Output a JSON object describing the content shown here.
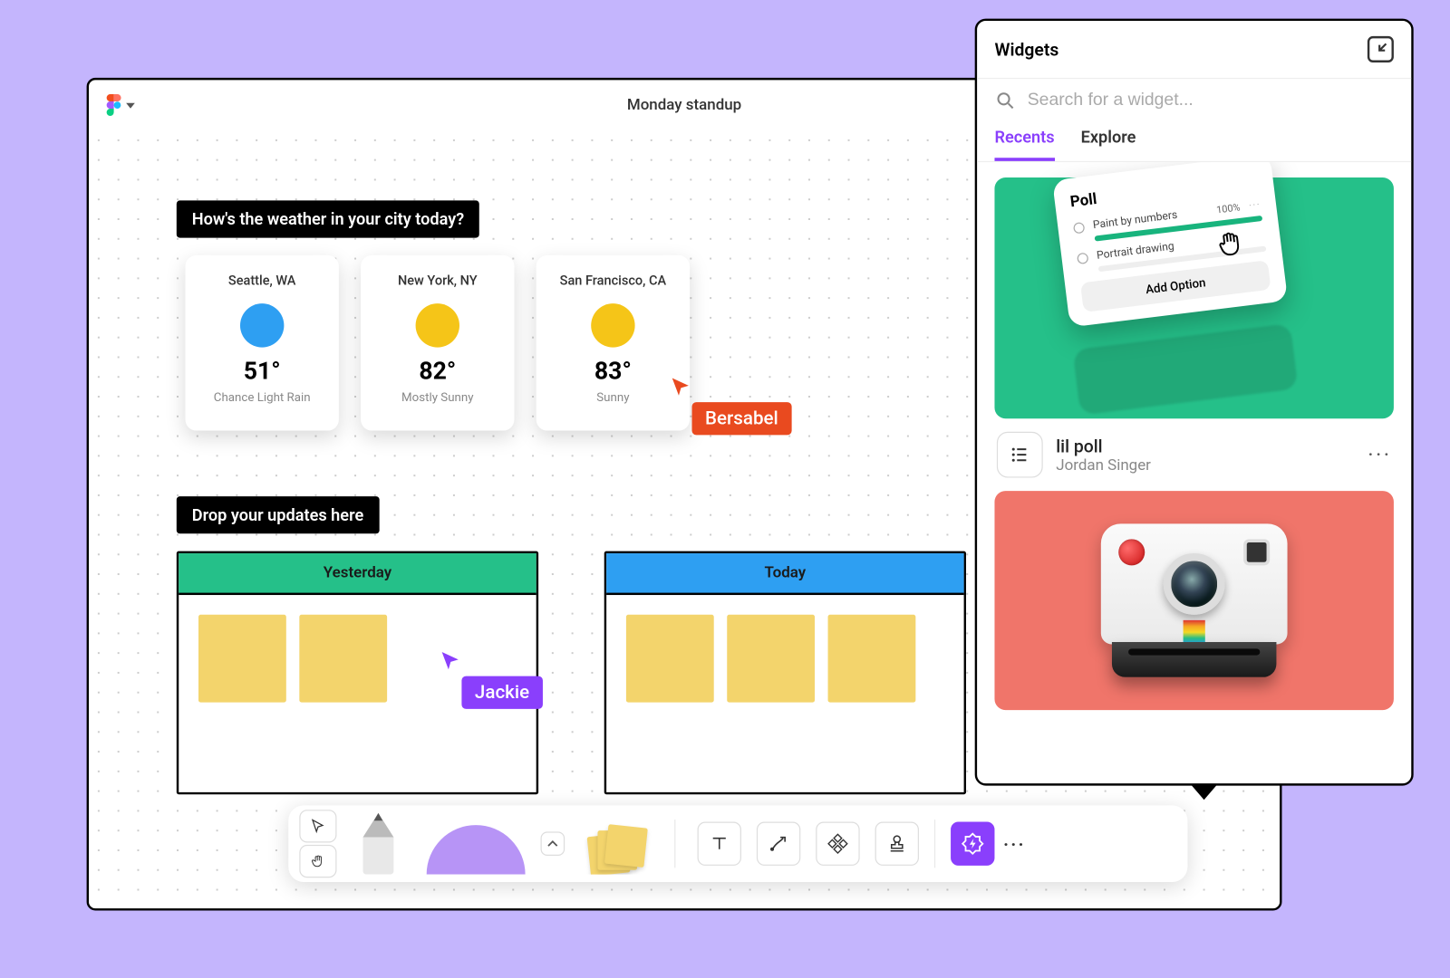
{
  "page": {
    "title": "Monday standup"
  },
  "sections": {
    "weather_q": "How's the weather in your city today?",
    "updates_q": "Drop your updates here"
  },
  "weather": [
    {
      "city": "Seattle, WA",
      "temp": "51°",
      "cond": "Chance Light Rain",
      "color": "blue"
    },
    {
      "city": "New York, NY",
      "temp": "82°",
      "cond": "Mostly Sunny",
      "color": "yellow"
    },
    {
      "city": "San Francisco, CA",
      "temp": "83°",
      "cond": "Sunny",
      "color": "yellow"
    }
  ],
  "cursors": {
    "red_user": "Bersabel",
    "purple_user": "Jackie"
  },
  "boards": {
    "left": "Yesterday",
    "right": "Today"
  },
  "widgets_panel": {
    "title": "Widgets",
    "search_placeholder": "Search for a widget...",
    "tabs": {
      "recents": "Recents",
      "explore": "Explore"
    },
    "poll": {
      "title": "Poll",
      "option1": "Paint by numbers",
      "option1_pct": "100%",
      "option2": "Portrait drawing",
      "add_option": "Add Option"
    },
    "item1": {
      "name": "lil poll",
      "author": "Jordan Singer"
    }
  }
}
